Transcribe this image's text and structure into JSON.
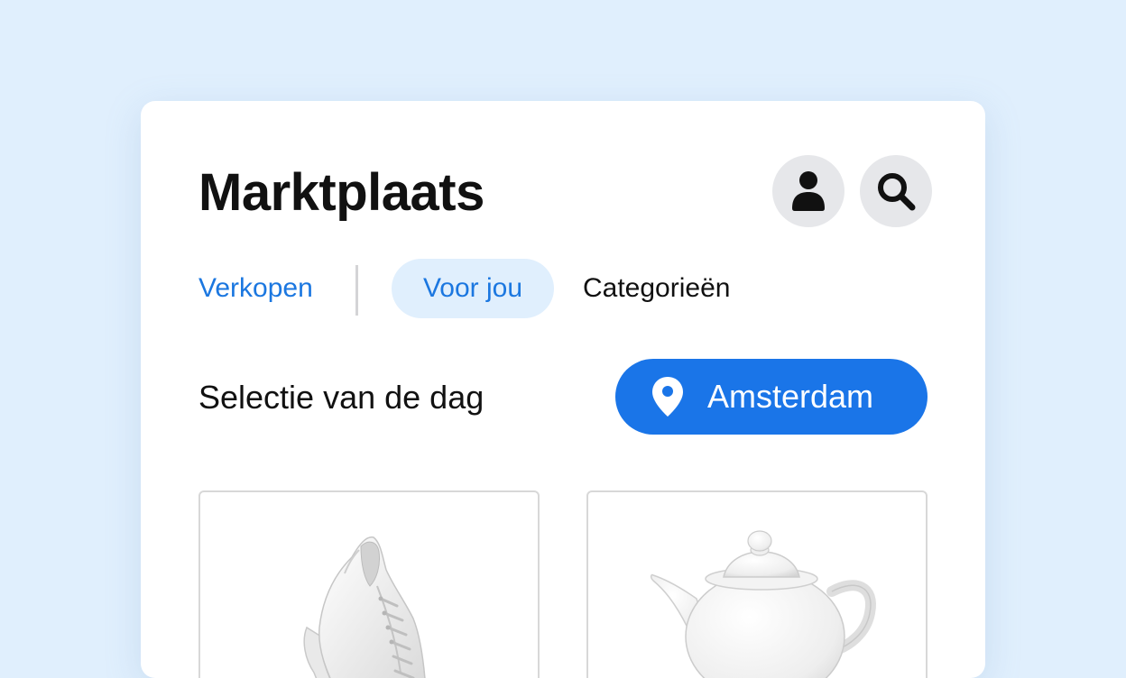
{
  "header": {
    "title": "Marktplaats",
    "profile_icon": "user-icon",
    "search_icon": "search-icon"
  },
  "tabs": [
    {
      "label": "Verkopen",
      "state": "link"
    },
    {
      "label": "Voor jou",
      "state": "selected"
    },
    {
      "label": "Categorieën",
      "state": "default"
    }
  ],
  "section": {
    "title": "Selectie van de dag"
  },
  "location": {
    "icon": "map-pin-icon",
    "label": "Amsterdam"
  },
  "products": [
    {
      "image": "white-sneaker"
    },
    {
      "image": "white-teapot"
    }
  ],
  "colors": {
    "background": "#e0effd",
    "accent": "#1a75e8",
    "link": "#1b77e0",
    "icon_button_bg": "#e6e7ea"
  }
}
